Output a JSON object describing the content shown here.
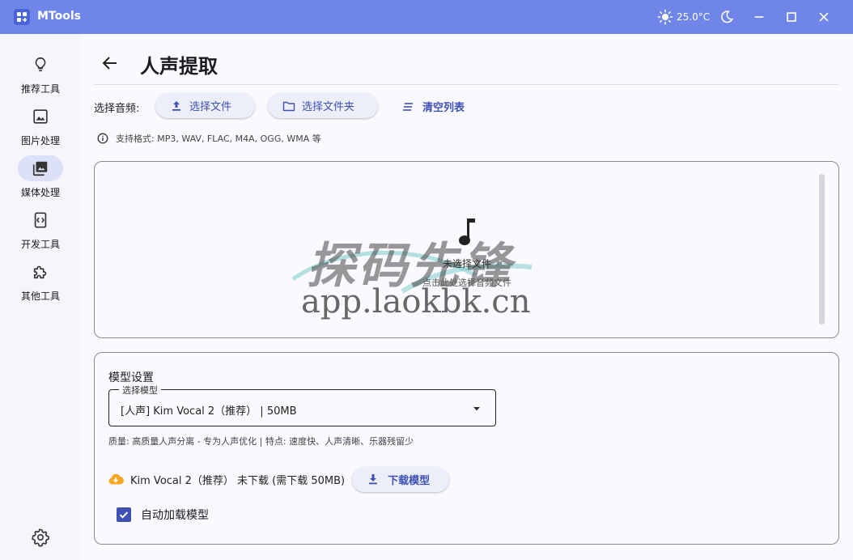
{
  "app": {
    "title": "MTools"
  },
  "titlebar": {
    "temperature": "25.0°C"
  },
  "sidebar": {
    "items": [
      {
        "label": "推荐工具",
        "icon": "lightbulb-icon"
      },
      {
        "label": "图片处理",
        "icon": "image-icon"
      },
      {
        "label": "媒体处理",
        "icon": "media-library-icon",
        "active": true
      },
      {
        "label": "开发工具",
        "icon": "code-icon"
      },
      {
        "label": "其他工具",
        "icon": "puzzle-icon"
      }
    ]
  },
  "page": {
    "title": "人声提取"
  },
  "toolbar": {
    "select_label": "选择音频:",
    "select_file": "选择文件",
    "select_folder": "选择文件夹",
    "clear_list": "清空列表"
  },
  "formats_hint": "支持格式: MP3, WAV, FLAC, M4A, OGG, WMA 等",
  "drop_zone": {
    "title": "未选择文件",
    "hint": "点击此处选择音频文件"
  },
  "watermark": {
    "brand": "探码先锋",
    "url": "app.laokbk.cn"
  },
  "model": {
    "heading": "模型设置",
    "select_label": "选择模型",
    "selected": "[人声] Kim Vocal 2（推荐） | 50MB",
    "description": "质量: 高质量人声分离 - 专为人声优化 | 特点: 速度快、人声清晰、乐器残留少",
    "download_status": "Kim Vocal 2（推荐） 未下载 (需下载 50MB)",
    "download_button": "下载模型",
    "auto_load_label": "自动加载模型",
    "auto_load_checked": true
  },
  "colors": {
    "titlebar": "#6f86e8",
    "accent": "#3f51b5",
    "cloud": "#f5a623"
  }
}
